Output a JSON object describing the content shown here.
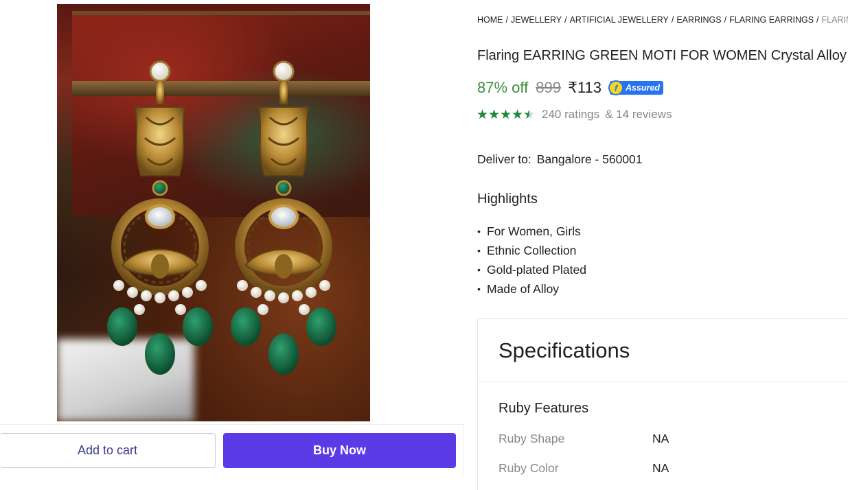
{
  "breadcrumb": [
    "HOME",
    "JEWELLERY",
    "ARTIFICIAL JEWELLERY",
    "EARRINGS",
    "FLARING EARRINGS",
    "FLARING"
  ],
  "product": {
    "title": "Flaring EARRING GREEN MOTI FOR WOMEN Crystal Alloy",
    "discount": "87% off",
    "mrp": "899",
    "price": "₹113",
    "assured_label": "Assured",
    "rating_value": 4.5,
    "ratings_text": "240 ratings",
    "reviews_text": "& 14 reviews"
  },
  "delivery": {
    "label": "Deliver to:",
    "location": "Bangalore - 560001"
  },
  "highlights": {
    "title": "Highlights",
    "items": [
      "For Women, Girls",
      "Ethnic Collection",
      "Gold-plated Plated",
      "Made of Alloy"
    ]
  },
  "specifications": {
    "title": "Specifications",
    "group": "Ruby Features",
    "rows": [
      {
        "key": "Ruby Shape",
        "value": "NA"
      },
      {
        "key": "Ruby Color",
        "value": "NA"
      }
    ]
  },
  "actions": {
    "add_to_cart": "Add to cart",
    "buy_now": "Buy Now"
  },
  "colors": {
    "discount": "#388e3c",
    "buy_now": "#5a3be6",
    "assured": "#2874f0",
    "star": "#1b8a3a"
  },
  "icons": {
    "assured": "flipkart-assured-icon",
    "star": "star-icon"
  }
}
